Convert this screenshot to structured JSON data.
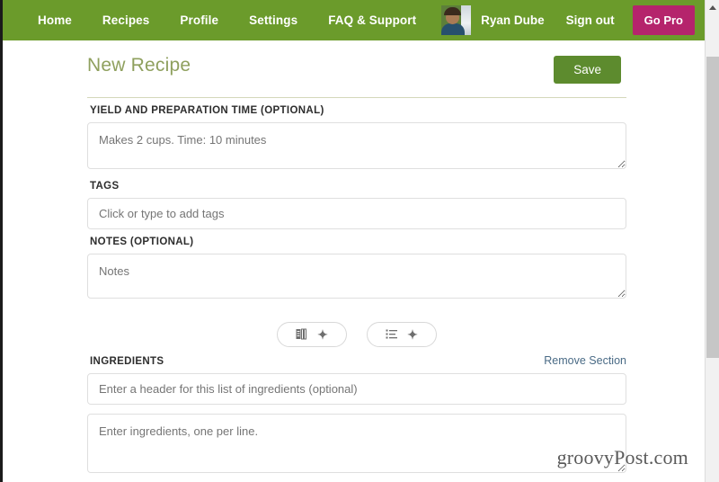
{
  "navbar": {
    "links": [
      {
        "label": "Home",
        "name": "nav-link-home"
      },
      {
        "label": "Recipes",
        "name": "nav-link-recipes"
      },
      {
        "label": "Profile",
        "name": "nav-link-profile"
      },
      {
        "label": "Settings",
        "name": "nav-link-settings"
      },
      {
        "label": "FAQ & Support",
        "name": "nav-link-faq-support"
      }
    ],
    "user_name": "Ryan Dube",
    "sign_out": "Sign out",
    "go_pro": "Go Pro",
    "bg_color": "#6b9b2b",
    "go_pro_color": "#b5246c",
    "avatar_icon": "user-avatar-photo"
  },
  "page": {
    "title": "New Recipe",
    "title_color": "#8fa05e",
    "save_label": "Save",
    "save_color": "#5d8b2e"
  },
  "fields": {
    "yield": {
      "label": "YIELD AND PREPARATION TIME (OPTIONAL)",
      "placeholder": "Makes 2 cups. Time: 10 minutes",
      "value": ""
    },
    "tags": {
      "label": "TAGS",
      "placeholder": "Click or type to add tags",
      "value": ""
    },
    "notes": {
      "label": "NOTES (OPTIONAL)",
      "placeholder": "Notes",
      "value": ""
    },
    "ingredients_header": {
      "placeholder": "Enter a header for this list of ingredients (optional)",
      "value": ""
    },
    "ingredients_body": {
      "placeholder": "Enter ingredients, one per line.",
      "value": ""
    }
  },
  "add_buttons": [
    {
      "icon": "add-section-icon",
      "plus": "✦",
      "name": "add-section-button"
    },
    {
      "icon": "add-list-icon",
      "plus": "✦",
      "name": "add-list-button"
    }
  ],
  "ingredients_section": {
    "label": "INGREDIENTS",
    "remove_label": "Remove Section",
    "remove_color": "#4a6b86"
  },
  "watermark": {
    "text": "groovyPost.com"
  },
  "scrollbar": {
    "up_arrow_icon": "scroll-up-arrow-icon"
  }
}
